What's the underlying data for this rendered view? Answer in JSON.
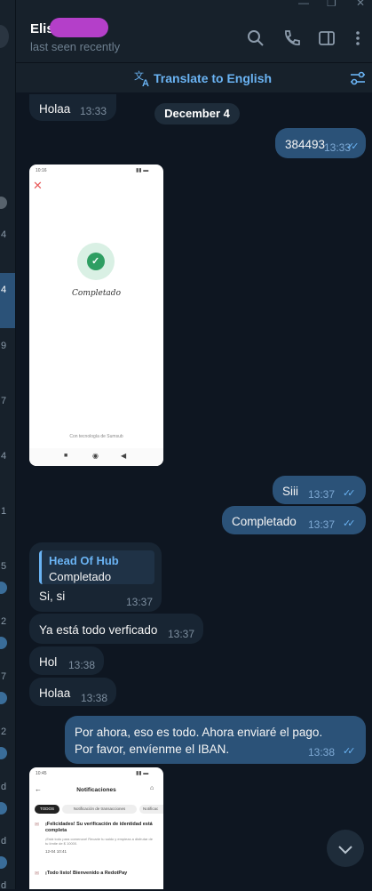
{
  "window": {
    "controls": [
      "—",
      "❐",
      "✕"
    ]
  },
  "sidebar": {
    "items": [
      "4",
      "4",
      "9",
      "7",
      "4",
      "1",
      "5",
      "2",
      "7",
      "2",
      "d",
      "d",
      "d"
    ],
    "icons": [
      "chat-avatar-icon"
    ]
  },
  "header": {
    "contact_name": "Elis",
    "status": "last seen recently",
    "icons": [
      "search-icon",
      "phone-icon",
      "sidebar-toggle-icon",
      "more-icon"
    ]
  },
  "translate_bar": {
    "label": "Translate to English",
    "icons": [
      "translate-icon",
      "translate-settings-icon"
    ]
  },
  "messages": [
    {
      "dir": "in",
      "text": "Holaa",
      "time": "13:33"
    },
    {
      "type": "date",
      "text": "December 4"
    },
    {
      "dir": "out",
      "text": "384493",
      "time": "13:33"
    },
    {
      "dir": "in",
      "type": "image",
      "screen": {
        "title": "Completado",
        "footer": "Con tecnología de Sumsub",
        "status_time": "10:16"
      }
    },
    {
      "dir": "out",
      "text": "Siii",
      "time": "13:37"
    },
    {
      "dir": "out",
      "text": "Completado",
      "time": "13:37"
    },
    {
      "dir": "in",
      "reply_to": {
        "author": "Head Of Hub",
        "text": "Completado"
      },
      "text": "Si, si",
      "time": "13:37"
    },
    {
      "dir": "in",
      "text": "Ya está todo verficado",
      "time": "13:37"
    },
    {
      "dir": "in",
      "text": "Hol",
      "time": "13:38"
    },
    {
      "dir": "in",
      "text": "Holaa",
      "time": "13:38"
    },
    {
      "dir": "out",
      "text": "Por ahora, eso es todo. Ahora enviaré el pago. Por favor, envíenme el IBAN.",
      "time": "13:38"
    },
    {
      "dir": "in",
      "type": "image",
      "screen": {
        "status_time": "10:45",
        "title": "Notificaciones",
        "tabs": [
          "TODOS",
          "Notificación de transacciones",
          "Notificac"
        ],
        "items": [
          {
            "title": "¡Felicidades! Su verificación de identidad está completa",
            "body": "¡Está todo para comenzar! Recarie tu saldo y empieza a disfrutar de tu límite de $ 10000.",
            "date": "12-04 10:41"
          },
          {
            "title": "¡Todo listo! Bienvenido a RedotPay"
          }
        ]
      }
    }
  ],
  "colors": {
    "accent": "#6ab3f3",
    "outgoing": "#2b5278",
    "incoming": "#182533",
    "background": "#0e1621",
    "check": "#2e9e62"
  }
}
